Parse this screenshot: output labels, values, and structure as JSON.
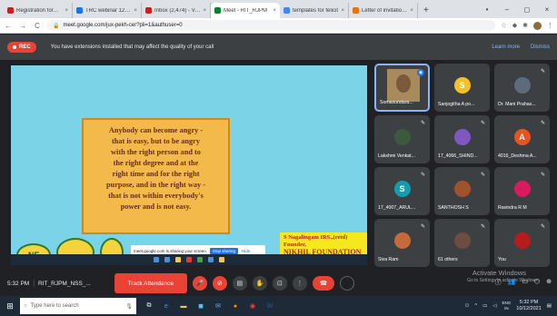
{
  "browser": {
    "tabs": [
      {
        "title": "Registration form for",
        "color": "#c5221f",
        "active": false
      },
      {
        "title": "TRC webinar 12.10.20",
        "color": "#1a73e8",
        "active": false
      },
      {
        "title": "Inbox (2,474) - Veluc",
        "color": "#c5221f",
        "active": false
      },
      {
        "title": "Meet - RIT_RJPM",
        "color": "#00832d",
        "active": true
      },
      {
        "title": "templates for felicit",
        "color": "#4285f4",
        "active": false
      },
      {
        "title": "Letter of invitation fo",
        "color": "#e8710a",
        "active": false
      }
    ],
    "tab_close": "×",
    "new_tab": "+",
    "window_controls": [
      "•",
      "–",
      "◻",
      "×"
    ],
    "url": "meet.google.com/jux-pekh-cer?pli=1&authuser=0",
    "nav": {
      "back": "←",
      "forward": "→",
      "reload": "C"
    }
  },
  "warning": {
    "rec_label": "REC",
    "message": "You have extensions installed that may affect the quality of your call",
    "learn_more": "Learn more",
    "dismiss": "Dismiss"
  },
  "slide": {
    "quote_lines": [
      "Anybody can become angry -",
      "that is easy, but to be angry",
      "with the right person and to",
      "the right degree and at the",
      "right time and for the right",
      "purpose, and in the right way -",
      "that is not within everybody's",
      "power and is not easy."
    ],
    "signature": {
      "name": "S Nagalingam IRS.,(retd)",
      "role": "Founder,",
      "org": "NIKHIL FOUNDATION"
    },
    "logo_text": "NF",
    "popup": {
      "text": "meet.google.com is sharing your screen",
      "stop": "Stop sharing",
      "hide": "Hide"
    }
  },
  "participants": [
    {
      "name": "Somasundara...",
      "type": "video",
      "speaking": true
    },
    {
      "name": "Sanjogitha A po...",
      "type": "avatar",
      "initial": "S",
      "color": "#f6c026",
      "muted": false
    },
    {
      "name": "Dr. Mani Prahas...",
      "type": "photo",
      "color": "#5f6b7a",
      "muted": true
    },
    {
      "name": "Lakshmi Venkat...",
      "type": "photo",
      "color": "#3d5a3e",
      "muted": true
    },
    {
      "name": "17_4066_SHIND...",
      "type": "photo",
      "color": "#7e57c2",
      "muted": true
    },
    {
      "name": "4016_Deshma A...",
      "type": "avatar",
      "initial": "A",
      "color": "#e8541f",
      "muted": true
    },
    {
      "name": "17_4007_ARUL...",
      "type": "avatar",
      "initial": "S",
      "color": "#129eaf",
      "muted": true
    },
    {
      "name": "SANTHOSH S",
      "type": "photo",
      "color": "#a0522d",
      "muted": true
    },
    {
      "name": "Ravindra R M",
      "type": "photo",
      "color": "#d81b60",
      "muted": true
    },
    {
      "name": "Siva Ram",
      "type": "photo",
      "color": "#c56a3a",
      "muted": true
    },
    {
      "name": "61 others",
      "type": "photo",
      "color": "#6d4c41",
      "muted": true
    },
    {
      "name": "You",
      "type": "photo",
      "color": "#b71c1c",
      "muted": true
    }
  ],
  "controls": {
    "time": "5:32 PM",
    "divider": "|",
    "meeting_code": "RIT_RJPM_NSS_...",
    "track_attendance": "Track Attendance",
    "activate_title": "Activate Windows",
    "activate_sub": "Go to Settings to activate Windows."
  },
  "taskbar": {
    "search_placeholder": "Type here to search",
    "time": "5:32 PM",
    "date": "10/12/2021",
    "lang_top": "ENG",
    "lang_bottom": "IN"
  }
}
